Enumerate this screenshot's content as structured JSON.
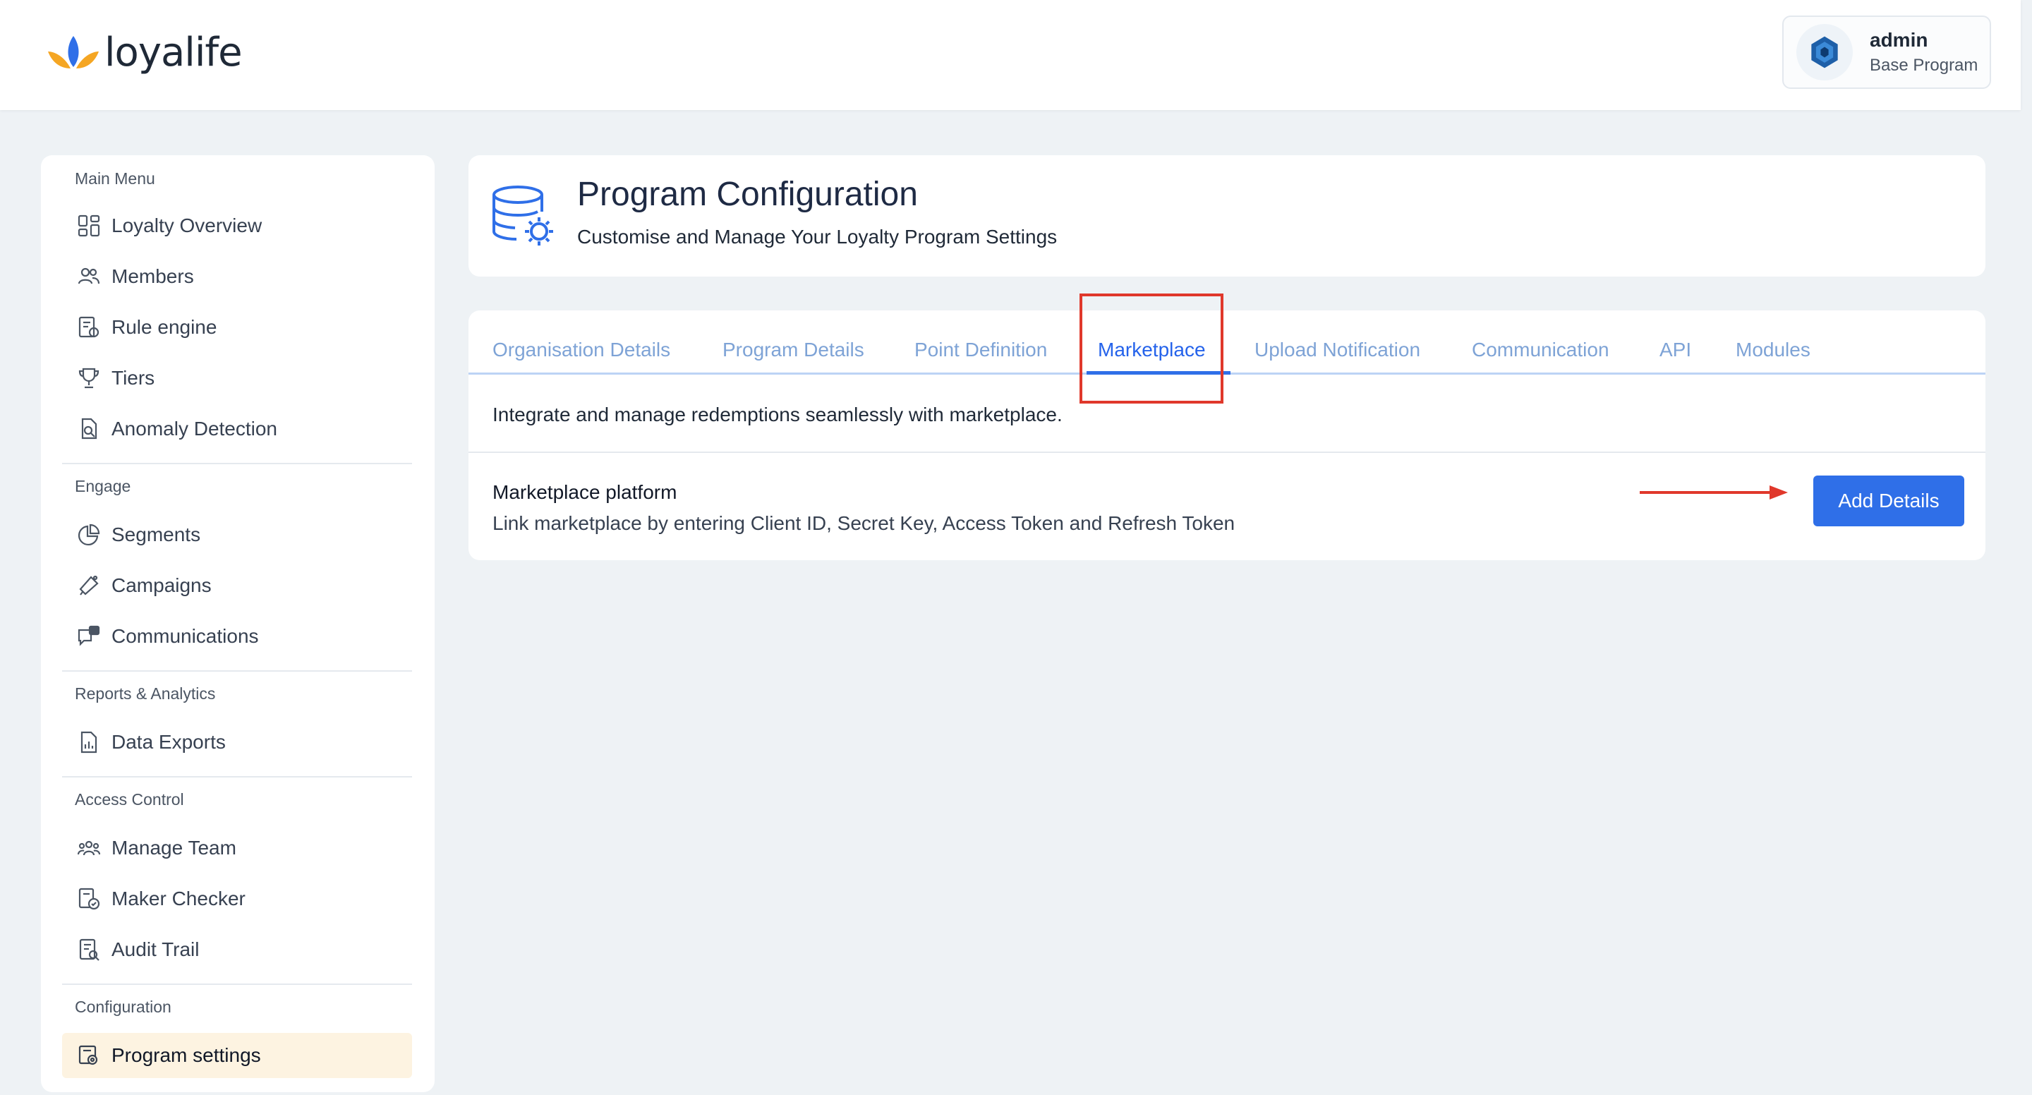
{
  "header": {
    "brand": "loyalife",
    "user_name": "admin",
    "user_program": "Base Program"
  },
  "sidebar": {
    "sections": [
      {
        "title": "Main Menu",
        "items": [
          {
            "label": "Loyalty Overview",
            "icon": "dashboard-icon"
          },
          {
            "label": "Members",
            "icon": "members-icon"
          },
          {
            "label": "Rule engine",
            "icon": "rule-engine-icon"
          },
          {
            "label": "Tiers",
            "icon": "trophy-icon"
          },
          {
            "label": "Anomaly Detection",
            "icon": "anomaly-detection-icon"
          }
        ]
      },
      {
        "title": "Engage",
        "items": [
          {
            "label": "Segments",
            "icon": "pie-chart-icon"
          },
          {
            "label": "Campaigns",
            "icon": "megaphone-icon"
          },
          {
            "label": "Communications",
            "icon": "chat-icon"
          }
        ]
      },
      {
        "title": "Reports & Analytics",
        "items": [
          {
            "label": "Data Exports",
            "icon": "report-file-icon"
          }
        ]
      },
      {
        "title": "Access Control",
        "items": [
          {
            "label": "Manage Team",
            "icon": "team-icon"
          },
          {
            "label": "Maker Checker",
            "icon": "maker-checker-icon"
          },
          {
            "label": "Audit Trail",
            "icon": "audit-trail-icon"
          }
        ]
      },
      {
        "title": "Configuration",
        "items": [
          {
            "label": "Program settings",
            "icon": "settings-icon",
            "active": true
          }
        ]
      }
    ]
  },
  "config": {
    "title": "Program Configuration",
    "subtitle": "Customise and Manage Your Loyalty Program Settings"
  },
  "tabs": [
    {
      "label": "Organisation Details"
    },
    {
      "label": "Program Details"
    },
    {
      "label": "Point Definition"
    },
    {
      "label": "Marketplace",
      "active": true
    },
    {
      "label": "Upload Notification"
    },
    {
      "label": "Communication"
    },
    {
      "label": "API"
    },
    {
      "label": "Modules"
    }
  ],
  "marketplace": {
    "description": "Integrate and manage redemptions seamlessly with marketplace.",
    "platform_title": "Marketplace platform",
    "platform_subtitle": "Link marketplace by entering Client ID, Secret Key, Access Token and Refresh Token",
    "add_button": "Add Details"
  },
  "colors": {
    "accent": "#2f6fe8",
    "tab_inactive": "#7ea3d6",
    "annotation_red": "#e0382b",
    "active_nav_bg": "#fdf3e1"
  }
}
